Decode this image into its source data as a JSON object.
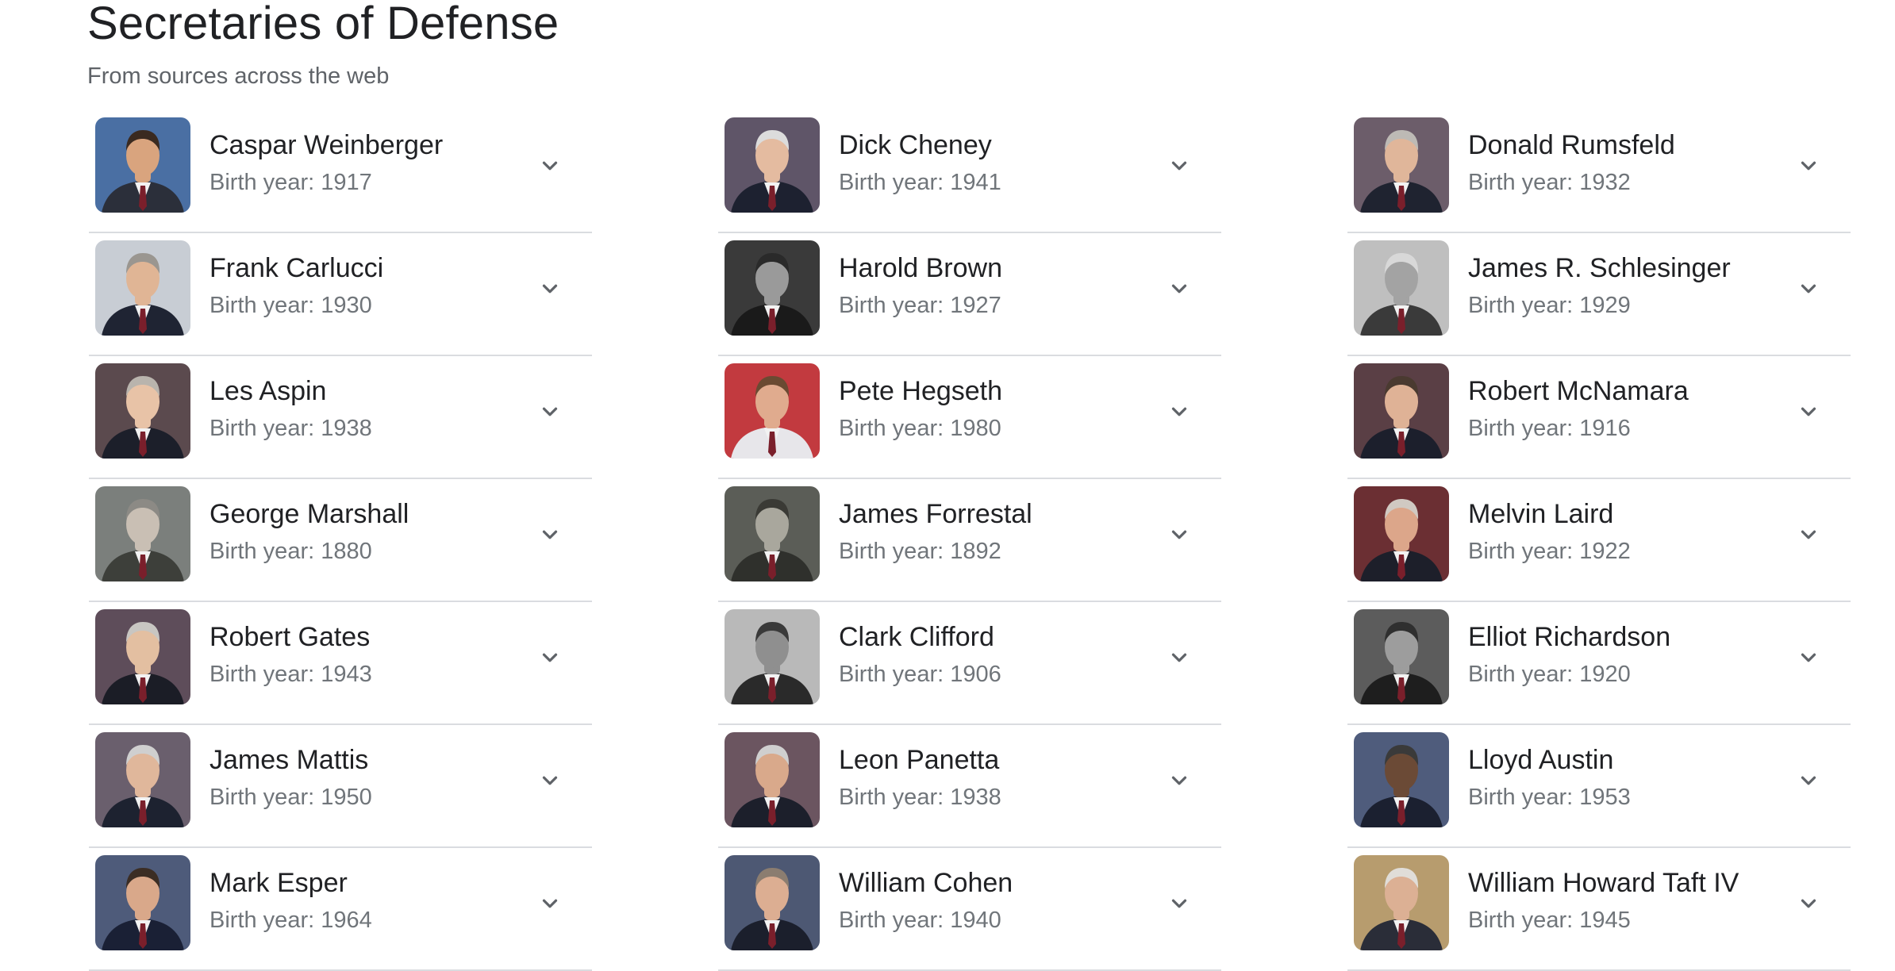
{
  "header": {
    "title": "Secretaries of Defense",
    "subtitle": "From sources across the web"
  },
  "icons": {
    "expand": "chevron-down-icon",
    "photo": "portrait-photo"
  },
  "colors": {
    "title": "#202124",
    "secondary_text": "#70757a",
    "divider": "#dadce0",
    "chevron": "#5f6368"
  },
  "columns": [
    {
      "items": [
        {
          "name": "Caspar Weinberger",
          "birth": "Birth year: 1917",
          "bg": "#4a6fa3",
          "suit": "#2b2f3a",
          "skin": "#d9a47e",
          "hair": "#3a2a20"
        },
        {
          "name": "Frank Carlucci",
          "birth": "Birth year: 1930",
          "bg": "#c8cdd4",
          "suit": "#1f2433",
          "skin": "#e0b595",
          "hair": "#9a9690"
        },
        {
          "name": "Les Aspin",
          "birth": "Birth year: 1938",
          "bg": "#5b4a4e",
          "suit": "#1c1f2a",
          "skin": "#e8c3a7",
          "hair": "#b9b4ad"
        },
        {
          "name": "George Marshall",
          "birth": "Birth year: 1880",
          "bg": "#7b7f7c",
          "suit": "#3d3f3a",
          "skin": "#c9bfb4",
          "hair": "#8c8a85"
        },
        {
          "name": "Robert Gates",
          "birth": "Birth year: 1943",
          "bg": "#5e4d5a",
          "suit": "#1b1d26",
          "skin": "#e3bfa1",
          "hair": "#c8c6c2"
        },
        {
          "name": "James Mattis",
          "birth": "Birth year: 1950",
          "bg": "#6a5f6d",
          "suit": "#1d2230",
          "skin": "#e0b79b",
          "hair": "#cfcfcf"
        },
        {
          "name": "Mark Esper",
          "birth": "Birth year: 1964",
          "bg": "#4e5b7a",
          "suit": "#1a2035",
          "skin": "#d9a88a",
          "hair": "#3b2d24"
        }
      ]
    },
    {
      "items": [
        {
          "name": "Dick Cheney",
          "birth": "Birth year: 1941",
          "bg": "#5f5568",
          "suit": "#1d2130",
          "skin": "#e4bba0",
          "hair": "#dcdcdc"
        },
        {
          "name": "Harold Brown",
          "birth": "Birth year: 1927",
          "bg": "#3a3a3a",
          "suit": "#1a1a1a",
          "skin": "#9a9a9a",
          "hair": "#2a2a2a"
        },
        {
          "name": "Pete Hegseth",
          "birth": "Birth year: 1980",
          "bg": "#c23a3f",
          "suit": "#e7e6ea",
          "skin": "#e0ab8e",
          "hair": "#6a4a32"
        },
        {
          "name": "James Forrestal",
          "birth": "Birth year: 1892",
          "bg": "#5b5d57",
          "suit": "#2f302c",
          "skin": "#a9a79d",
          "hair": "#3a3a35"
        },
        {
          "name": "Clark Clifford",
          "birth": "Birth year: 1906",
          "bg": "#b9b9b9",
          "suit": "#2a2a2a",
          "skin": "#8f8f8f",
          "hair": "#3a3a3a"
        },
        {
          "name": "Leon Panetta",
          "birth": "Birth year: 1938",
          "bg": "#6b5560",
          "suit": "#1c1f2b",
          "skin": "#d9a98b",
          "hair": "#cfcfcf"
        },
        {
          "name": "William Cohen",
          "birth": "Birth year: 1940",
          "bg": "#4d5873",
          "suit": "#1b1f2c",
          "skin": "#dcae92",
          "hair": "#8b7d70"
        }
      ]
    },
    {
      "items": [
        {
          "name": "Donald Rumsfeld",
          "birth": "Birth year: 1932",
          "bg": "#6c5d6a",
          "suit": "#1f2330",
          "skin": "#e0b69a",
          "hair": "#bdbab5"
        },
        {
          "name": "James R. Schlesinger",
          "birth": "Birth year: 1929",
          "bg": "#bfbfbf",
          "suit": "#3a3a3a",
          "skin": "#a3a3a3",
          "hair": "#d8d8d8"
        },
        {
          "name": "Robert McNamara",
          "birth": "Birth year: 1916",
          "bg": "#5a3f45",
          "suit": "#1c1f2c",
          "skin": "#dfb296",
          "hair": "#4a3a30"
        },
        {
          "name": "Melvin Laird",
          "birth": "Birth year: 1922",
          "bg": "#6b2f33",
          "suit": "#1d1f2a",
          "skin": "#dca68a",
          "hair": "#d0c9c2"
        },
        {
          "name": "Elliot Richardson",
          "birth": "Birth year: 1920",
          "bg": "#5c5c5c",
          "suit": "#1e1e1e",
          "skin": "#9d9d9d",
          "hair": "#2f2f2f"
        },
        {
          "name": "Lloyd Austin",
          "birth": "Birth year: 1953",
          "bg": "#4f5c7c",
          "suit": "#1b2030",
          "skin": "#6b4a36",
          "hair": "#3a3a3a"
        },
        {
          "name": "William Howard Taft IV",
          "birth": "Birth year: 1945",
          "bg": "#b79c6e",
          "suit": "#2a2d38",
          "skin": "#dcb094",
          "hair": "#e0ddd8"
        }
      ]
    }
  ]
}
